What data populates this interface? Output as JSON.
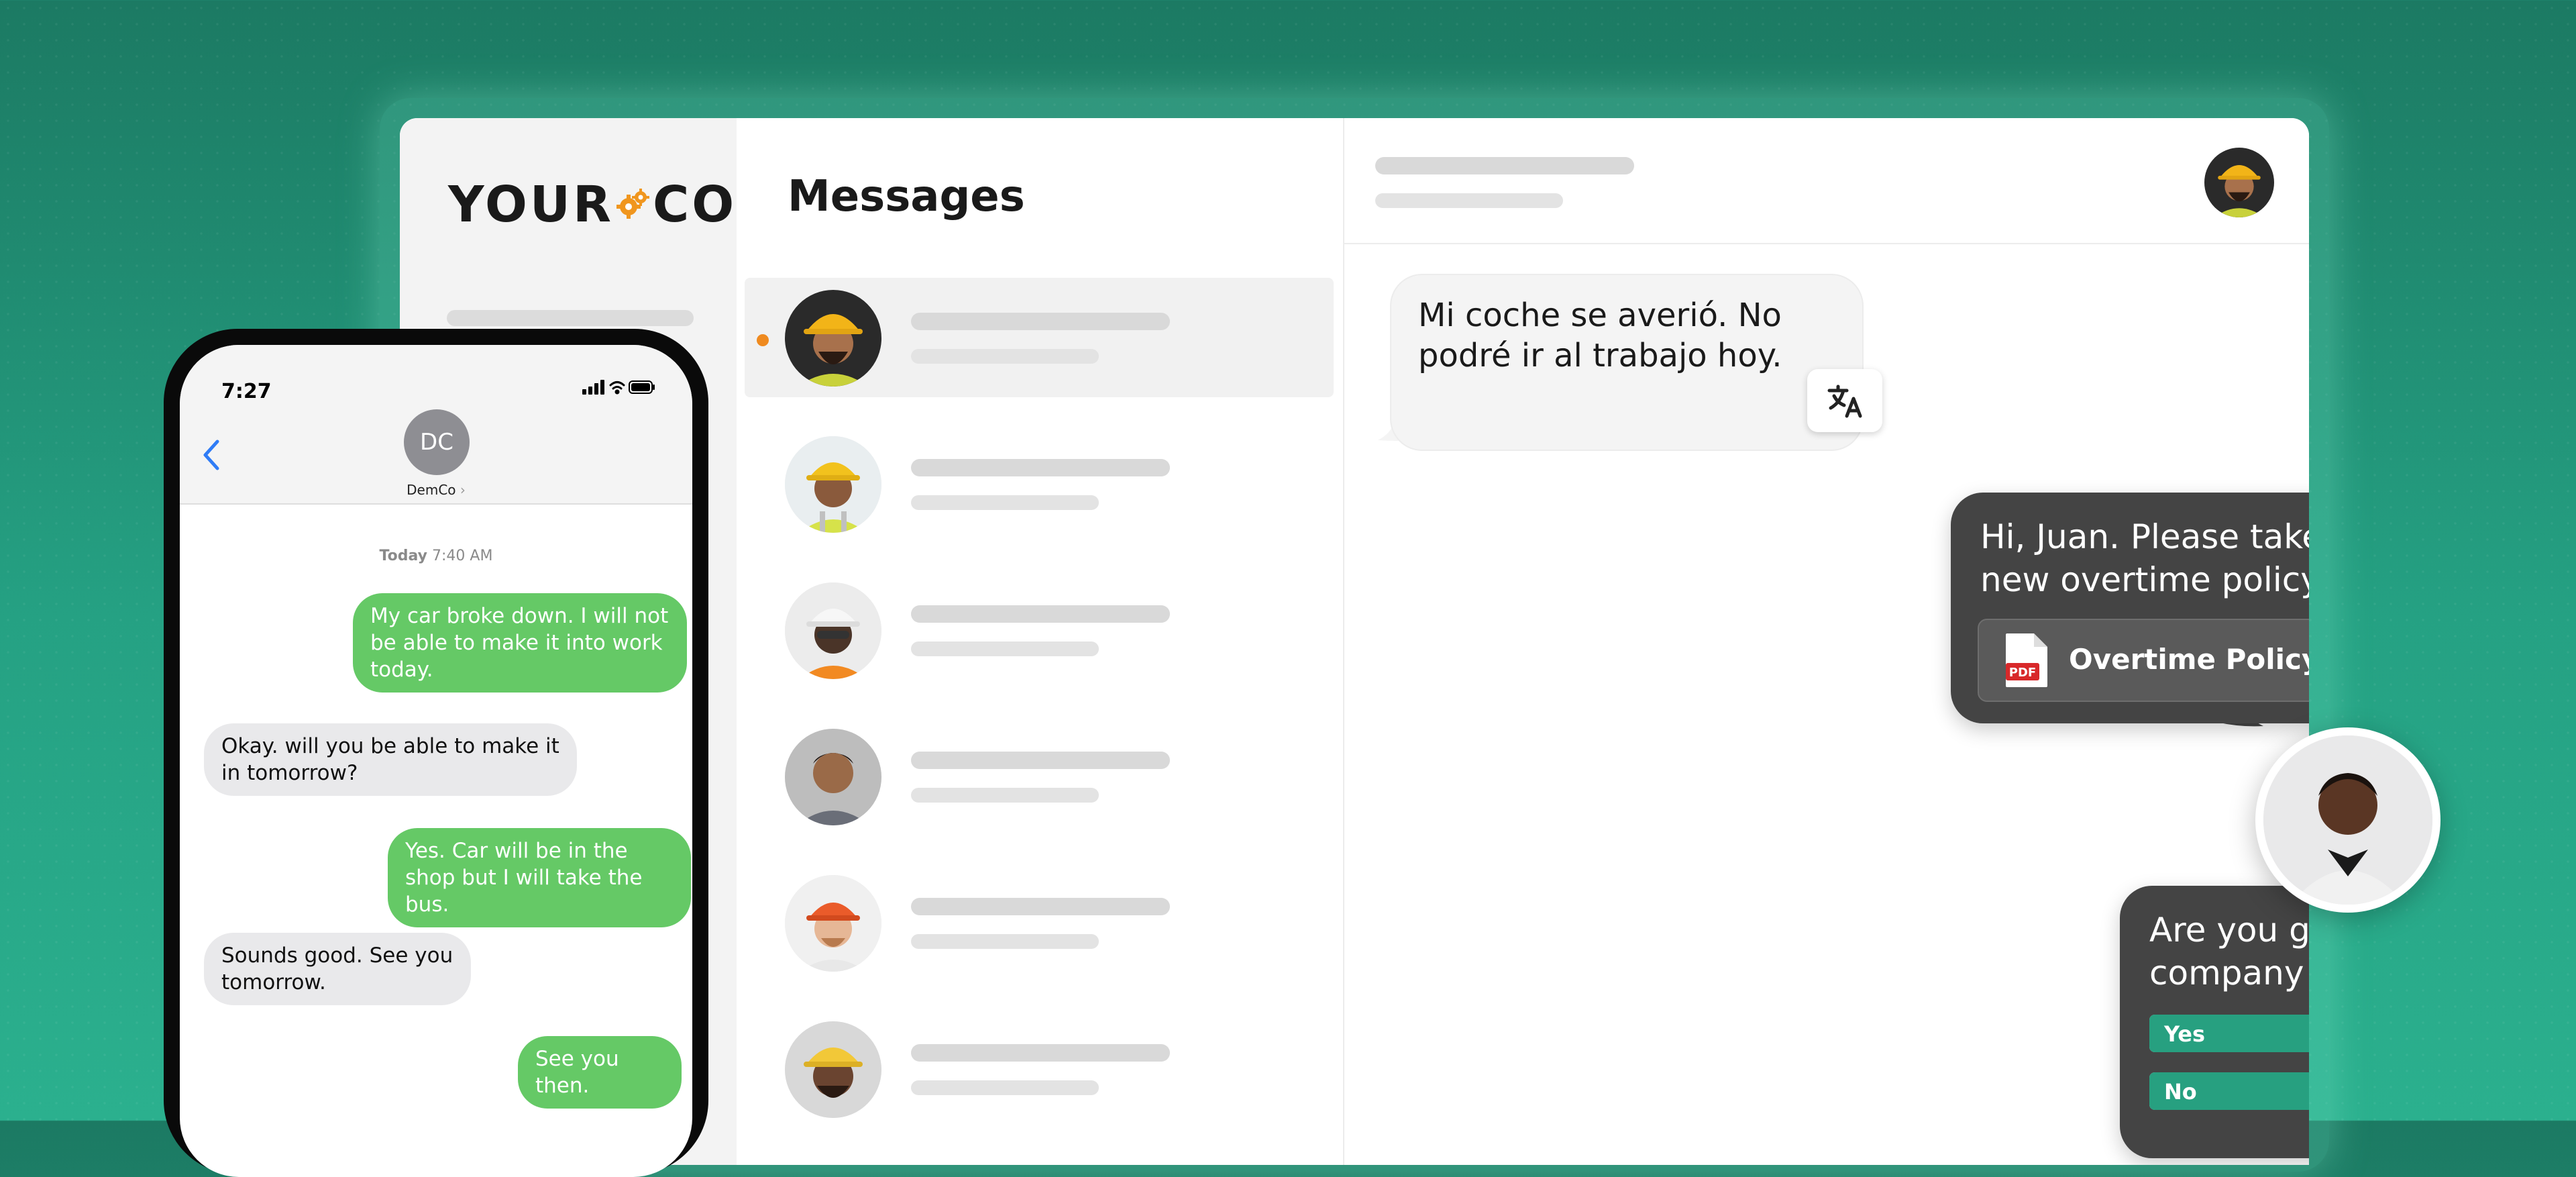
{
  "brand": {
    "logo_left": "YOUR",
    "logo_right": "CO",
    "accent_color": "#25a183",
    "dot_color": "#ef8a1f"
  },
  "messages_panel": {
    "title": "Messages",
    "conversations": [
      {
        "avatar": "worker-yellow-hardhat-avatar",
        "unread": true,
        "active": true
      },
      {
        "avatar": "worker-yellow-hardhat-vest-avatar",
        "unread": false,
        "active": false
      },
      {
        "avatar": "worker-white-hardhat-avatar",
        "unread": false,
        "active": false
      },
      {
        "avatar": "worker-smiling-avatar",
        "unread": false,
        "active": false
      },
      {
        "avatar": "worker-red-hardhat-avatar",
        "unread": false,
        "active": false
      },
      {
        "avatar": "worker-yellow-hardhat-beard-avatar",
        "unread": false,
        "active": false
      }
    ]
  },
  "chat": {
    "incoming_message": "Mi coche se averió. No podré ir al trabajo hoy.",
    "outgoing_message": "Hi, Juan. Please take a look at our new overtime policy.",
    "attachment": {
      "icon_label": "PDF",
      "file_name": "Overtime Policy.pdf"
    },
    "poll": {
      "question": "Are you going to attend the company event on Friday?",
      "options": [
        {
          "label": "Yes",
          "fill": 0.76
        },
        {
          "label": "No",
          "fill": 0.33
        }
      ]
    }
  },
  "phone": {
    "time": "7:27",
    "contact_initials": "DC",
    "contact_name": "DemCo",
    "contact_chevron": "›",
    "day_label": "Today",
    "day_time": "7:40 AM",
    "messages": [
      {
        "from": "me",
        "text": "My car broke down. I will not be able to make it into work today."
      },
      {
        "from": "them",
        "text": "Okay. will you be able to make it in tomorrow?"
      },
      {
        "from": "me",
        "text": "Yes. Car will be in the shop but I will take the bus."
      },
      {
        "from": "them",
        "text": "Sounds good. See you tomorrow."
      },
      {
        "from": "me",
        "text": "See you then."
      }
    ]
  }
}
